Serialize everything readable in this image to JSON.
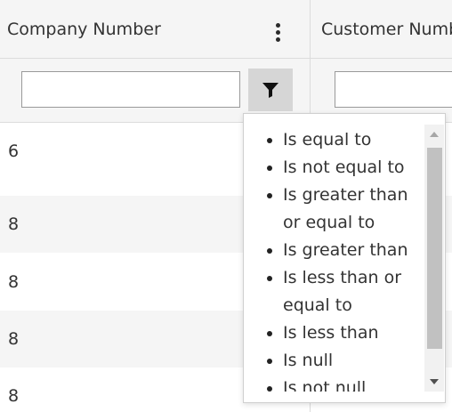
{
  "columns": {
    "col1_header": "Company Number",
    "col2_header": "Customer Numb"
  },
  "filter": {
    "col1_value": "",
    "col2_value": ""
  },
  "rows": [
    {
      "company_number": "6"
    },
    {
      "company_number": "8"
    },
    {
      "company_number": "8"
    },
    {
      "company_number": "8"
    },
    {
      "company_number": "8"
    }
  ],
  "filter_menu": {
    "options": [
      "Is equal to",
      "Is not equal to",
      "Is greater than or equal to",
      "Is greater than",
      "Is less than or equal to",
      "Is less than",
      "Is null",
      "Is not null"
    ]
  },
  "icons": {
    "column_menu": "kebab-icon",
    "filter": "filter-icon",
    "scroll_up": "triangle-up-icon",
    "scroll_down": "triangle-down-icon"
  },
  "colors": {
    "header_bg": "#f5f5f5",
    "alt_row_bg": "#f5f5f5",
    "filter_button_bg": "#d6d6d6",
    "scroll_thumb": "#c1c1c1"
  }
}
